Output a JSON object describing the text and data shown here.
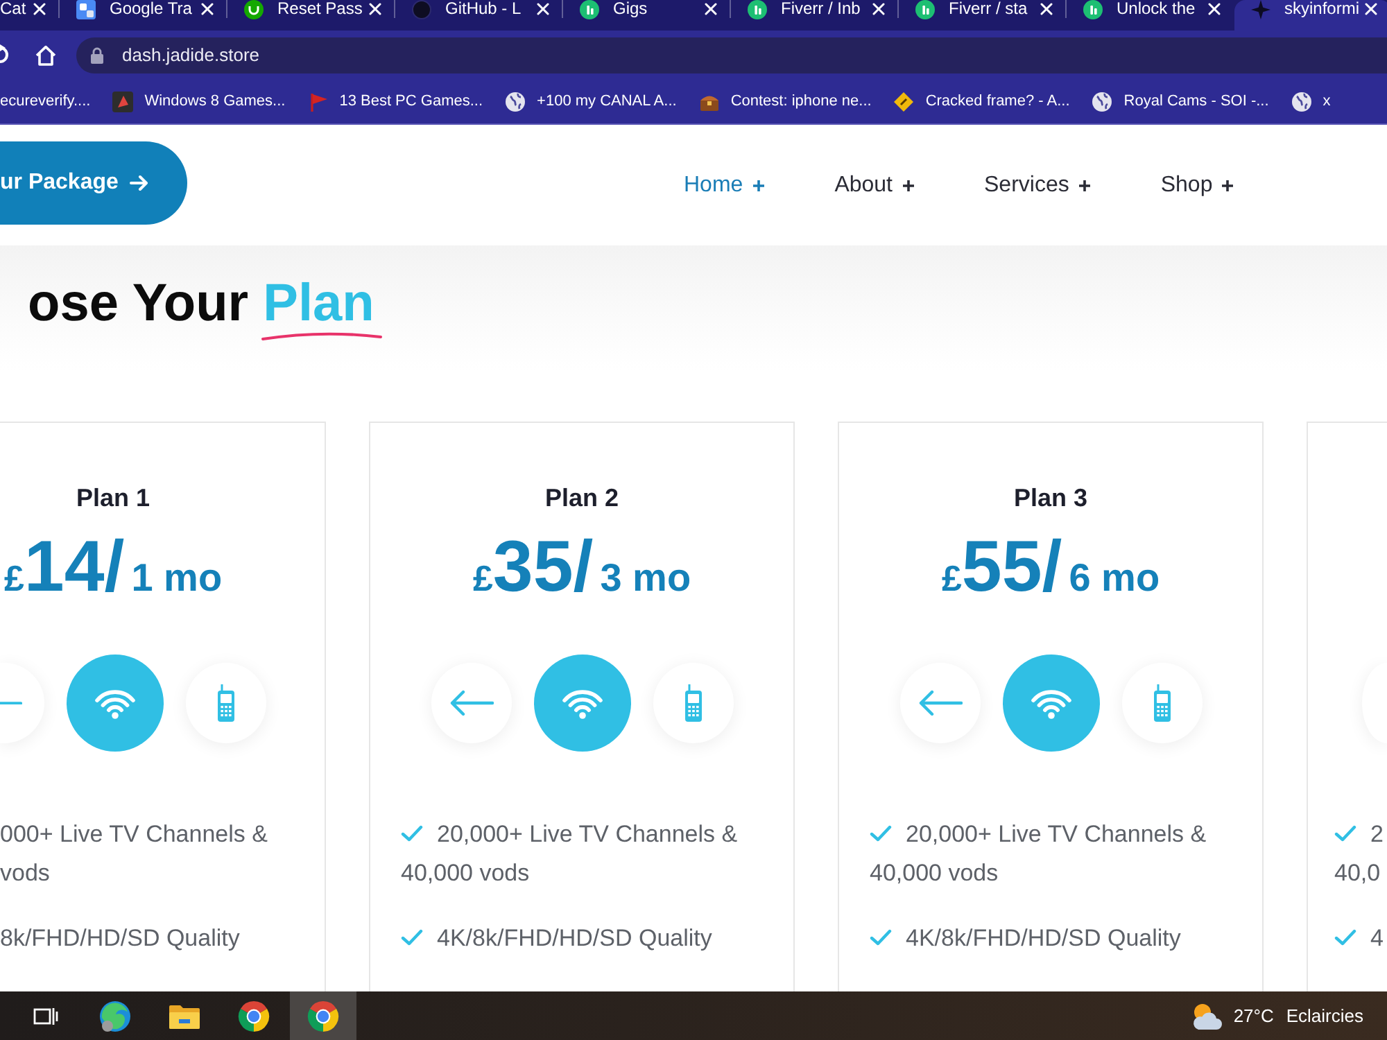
{
  "browser": {
    "tabs": [
      {
        "title": "Cat",
        "selected": false
      },
      {
        "title": "Google Tra",
        "kind": "translate",
        "selected": false
      },
      {
        "title": "Reset Pass",
        "kind": "upwork",
        "selected": false
      },
      {
        "title": "GitHub - L",
        "kind": "github",
        "selected": false
      },
      {
        "title": "Gigs",
        "kind": "fiverr",
        "selected": false
      },
      {
        "title": "Fiverr / Inb",
        "kind": "fiverr",
        "selected": false
      },
      {
        "title": "Fiverr / sta",
        "kind": "fiverr",
        "selected": false
      },
      {
        "title": "Unlock the",
        "kind": "fiverr",
        "selected": false
      },
      {
        "title": "skyinformi",
        "kind": "star",
        "selected": true
      }
    ],
    "url": "dash.jadide.store",
    "bookmarks": [
      {
        "label": "ecureverify...."
      },
      {
        "label": "Windows 8 Games...",
        "kind": "game"
      },
      {
        "label": "13 Best PC Games...",
        "kind": "flag"
      },
      {
        "label": "+100 my CANAL A...",
        "kind": "globe"
      },
      {
        "label": "Contest: iphone ne...",
        "kind": "chest"
      },
      {
        "label": "Cracked frame? - A...",
        "kind": "diamond"
      },
      {
        "label": "Royal Cams - SOI -...",
        "kind": "globe"
      },
      {
        "label": "x",
        "kind": "globe"
      }
    ]
  },
  "site": {
    "package_button": {
      "label": "ur Package"
    },
    "nav": [
      {
        "label": "Home",
        "selected": true
      },
      {
        "label": "About",
        "selected": false
      },
      {
        "label": "Services",
        "selected": false
      },
      {
        "label": "Shop",
        "selected": false
      }
    ],
    "heading": {
      "text": "ose Your",
      "highlight": "Plan"
    },
    "plans": [
      {
        "title": "Plan 1",
        "price": {
          "currency": "£",
          "amount": "14/",
          "period": "1 mo"
        },
        "icons": [
          {
            "kind": "arrow",
            "selected": false
          },
          {
            "kind": "wifi",
            "selected": true
          },
          {
            "kind": "phone",
            "selected": false
          }
        ],
        "features": [
          {
            "text": "000+ Live TV Channels & vods",
            "check": false
          },
          {
            "text": "8k/FHD/HD/SD Quality",
            "check": false
          }
        ]
      },
      {
        "title": "Plan 2",
        "price": {
          "currency": "£",
          "amount": "35/",
          "period": "3 mo"
        },
        "icons": [
          {
            "kind": "arrow",
            "selected": false
          },
          {
            "kind": "wifi",
            "selected": true
          },
          {
            "kind": "phone",
            "selected": false
          }
        ],
        "features": [
          {
            "text": "20,000+ Live TV Channels & 40,000 vods",
            "check": true
          },
          {
            "text": "4K/8k/FHD/HD/SD Quality",
            "check": true
          }
        ]
      },
      {
        "title": "Plan 3",
        "price": {
          "currency": "£",
          "amount": "55/",
          "period": "6 mo"
        },
        "icons": [
          {
            "kind": "arrow",
            "selected": false
          },
          {
            "kind": "wifi",
            "selected": true
          },
          {
            "kind": "phone",
            "selected": false
          }
        ],
        "features": [
          {
            "text": "20,000+ Live TV Channels & 40,000 vods",
            "check": true
          },
          {
            "text": "4K/8k/FHD/HD/SD Quality",
            "check": true
          }
        ]
      },
      {
        "icons": [
          {
            "selected": false
          }
        ],
        "features": [
          {
            "text": "2 40,0",
            "check": true
          },
          {
            "text": "4",
            "check": true
          }
        ]
      }
    ]
  },
  "taskbar": {
    "apps": [
      {
        "kind": "taskview",
        "selected": false
      },
      {
        "kind": "edge",
        "selected": false
      },
      {
        "kind": "folder",
        "selected": false
      },
      {
        "kind": "chrome",
        "selected": false
      },
      {
        "kind": "chrome",
        "selected": true
      }
    ],
    "weather": {
      "temperature": "27°C",
      "condition": "Eclaircies"
    }
  }
}
